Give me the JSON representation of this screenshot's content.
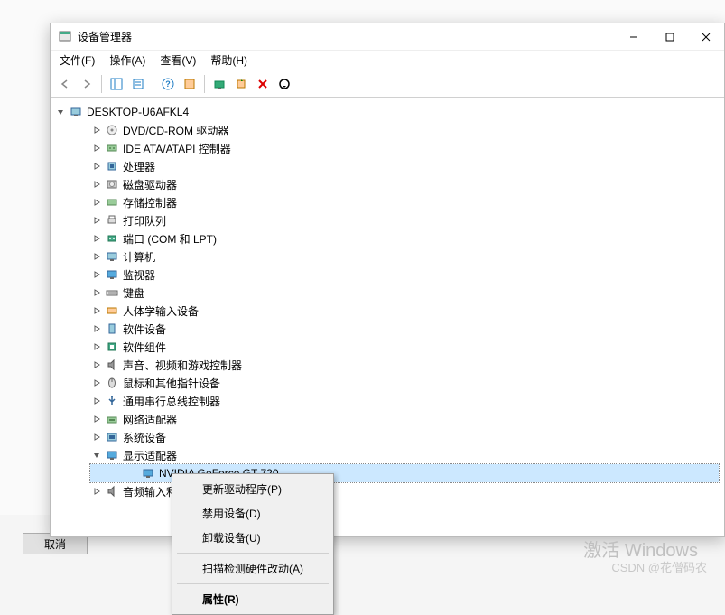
{
  "window": {
    "title": "设备管理器"
  },
  "menu": {
    "file": "文件(F)",
    "action": "操作(A)",
    "view": "查看(V)",
    "help": "帮助(H)"
  },
  "tree": {
    "root": "DESKTOP-U6AFKL4",
    "items": [
      {
        "label": "DVD/CD-ROM 驱动器",
        "icon": "disc"
      },
      {
        "label": "IDE ATA/ATAPI 控制器",
        "icon": "ide"
      },
      {
        "label": "处理器",
        "icon": "cpu"
      },
      {
        "label": "磁盘驱动器",
        "icon": "disk"
      },
      {
        "label": "存储控制器",
        "icon": "storage"
      },
      {
        "label": "打印队列",
        "icon": "printer"
      },
      {
        "label": "端口 (COM 和 LPT)",
        "icon": "port"
      },
      {
        "label": "计算机",
        "icon": "computer"
      },
      {
        "label": "监视器",
        "icon": "monitor"
      },
      {
        "label": "键盘",
        "icon": "keyboard"
      },
      {
        "label": "人体学输入设备",
        "icon": "hid"
      },
      {
        "label": "软件设备",
        "icon": "software"
      },
      {
        "label": "软件组件",
        "icon": "component"
      },
      {
        "label": "声音、视频和游戏控制器",
        "icon": "sound"
      },
      {
        "label": "鼠标和其他指针设备",
        "icon": "mouse"
      },
      {
        "label": "通用串行总线控制器",
        "icon": "usb"
      },
      {
        "label": "网络适配器",
        "icon": "network"
      },
      {
        "label": "系统设备",
        "icon": "system"
      }
    ],
    "display_adapters": "显示适配器",
    "gpu": "NVIDIA GeForce GT 720",
    "audio": "音频输入和"
  },
  "context": {
    "update": "更新驱动程序(P)",
    "disable": "禁用设备(D)",
    "uninstall": "卸载设备(U)",
    "scan": "扫描检测硬件改动(A)",
    "properties": "属性(R)"
  },
  "cancel": "取消",
  "watermark1": "激活 Windows",
  "watermark2": "CSDN @花僧码农"
}
